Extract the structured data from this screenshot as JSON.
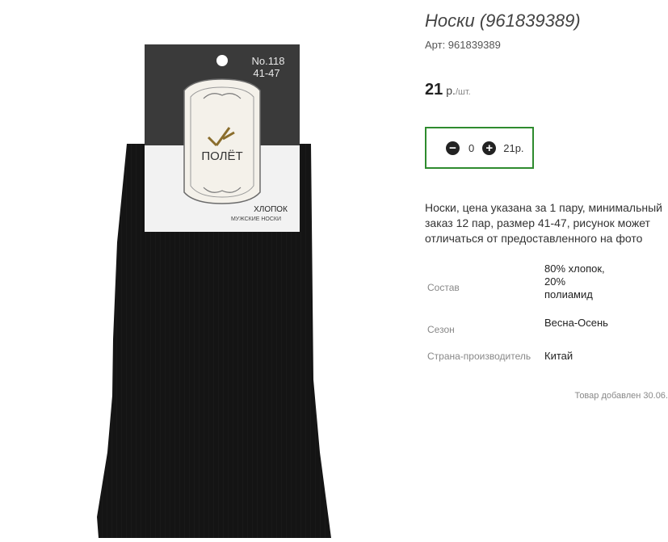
{
  "product": {
    "title": "Носки (961839389)",
    "sku": "Арт: 961839389",
    "price_amount": "21",
    "price_currency": "р.",
    "price_unit": "/шт.",
    "description": "Носки, цена указана за 1 пару, минимальный заказ 12 пар, размер 41-47, рисунок может отличаться от предоставленного на фото",
    "added": "Товар добавлен 30.06."
  },
  "image": {
    "tag_number": "No.118",
    "tag_size": "41-47",
    "brand": "ПОЛЁТ",
    "material": "ХЛОПОК",
    "type": "МУЖСКИЕ НОСКИ"
  },
  "quantity": {
    "value": "0",
    "sum": "21р.",
    "border_color": "#2e8b2e"
  },
  "specs": [
    {
      "label": "Состав",
      "value": "80% хлопок, 20% полиамид"
    },
    {
      "label": "Сезон",
      "value": "Весна-Осень"
    },
    {
      "label": "Страна-производитель",
      "value": "Китай"
    }
  ]
}
